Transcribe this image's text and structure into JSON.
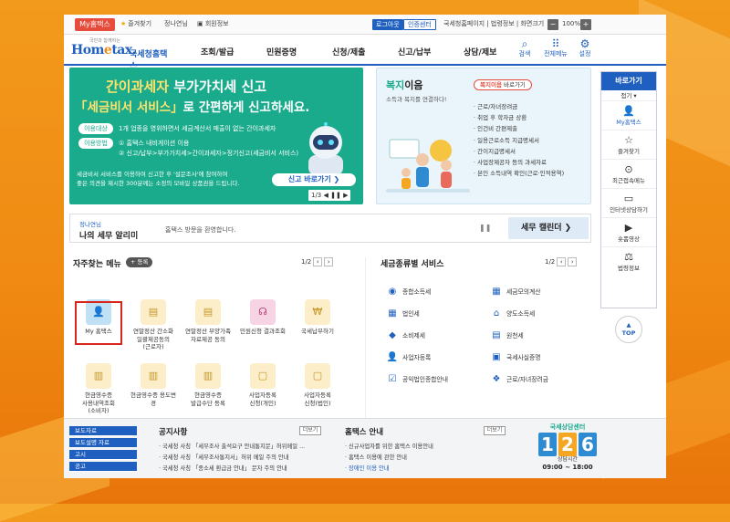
{
  "util": {
    "mytax": "My홈택스",
    "favorite": "즐겨찾기",
    "user": "정나연님",
    "member_info": "회원정보",
    "logout": "로그아웃",
    "auth_center": "인증센터",
    "links": "국세청홈페이지 | 법령정보 | 화면크기",
    "zoom": "100%"
  },
  "header": {
    "logo_sub": "국민과 함께하는",
    "logo_main_a": "Hom",
    "logo_main_e": "e",
    "logo_main_b": "tax.",
    "logo_kr": "국세청홈택스",
    "gnb": [
      "조회/발급",
      "민원증명",
      "신청/제출",
      "신고/납부",
      "상담/제보"
    ],
    "search": "검색",
    "all_menu": "전체메뉴",
    "settings": "설정"
  },
  "banner": {
    "line1_a": "간이과세자",
    "line1_b": " 부가가치세 신고",
    "line2_a": "「세금비서 서비스」",
    "line2_b": "로 간편하게 신고하세요.",
    "tag1": "이용대상",
    "text1": "1개 업종을 영위하면서 세금계산서 매출이 없는 간이과세자",
    "tag2": "이용방법",
    "text2a": "① 홈택스 내비게이션 이용",
    "text2b": "② 신고/납부>부가가치세>간이과세자>정기신고(세금비서 서비스)",
    "foot1": "세금비서 서비스를 이용하여 신고한 후 '설문조사'에 참여하여",
    "foot2": "좋은 의견을 제시한 300분께는 소정의 모바일 상품권을 드립니다.",
    "cta": "신고 바로가기 ❯",
    "page": "1/3"
  },
  "welfare": {
    "title_a": "복지",
    "title_b": "이음",
    "btn_a": "복지이음",
    "btn_b": " 바로가기",
    "sub": "소득과 복지를 연결하다!",
    "items": [
      "근로/자녀장려금",
      "취업 후 학자금 상환",
      "인건비 간편제출",
      "일용근로소득 지급명세서",
      "간이지급명세서",
      "사업장제공자 등의 과세자료",
      "본인 소득내역 확인(근로·인적용역)"
    ]
  },
  "quick": {
    "title": "바로가기",
    "fold": "접기 ▾",
    "items": [
      "My홈택스",
      "즐겨찾기",
      "최근접속메뉴",
      "인터넷상담하기",
      "숏폼영상",
      "법령정보"
    ],
    "top": "TOP"
  },
  "strip": {
    "name": "정나연님",
    "title": "나의 세무 알리미",
    "msg": "홈택스 방문을 환영합니다.",
    "calendar": "세무 캘린더  ❯"
  },
  "freq": {
    "title": "자주찾는 메뉴",
    "add": "+ 등록",
    "page": "1/2",
    "items": [
      "My 홈택스",
      "연말정산 간소화\n일괄제공동의\n(근로자)",
      "연말정산 부양가족\n자료제공 동의",
      "민원신청 결과조회",
      "국세납부하기",
      "현금영수증\n사용내역조회\n(소비자)",
      "현금영수증 용도변\n경",
      "현금영수증\n발급수단 등록",
      "사업자등록\n신청(개인)",
      "사업자등록\n신청(법인)"
    ]
  },
  "svc": {
    "title": "세금종류별 서비스",
    "page": "1/2",
    "left": [
      "종합소득세",
      "법인세",
      "소비제세",
      "사업자등록",
      "공익법인종합안내"
    ],
    "right": [
      "세금모의계산",
      "양도소득세",
      "원천세",
      "국세사실증명",
      "근로/자녀장려금"
    ]
  },
  "footer": {
    "tabs": [
      "보도자료",
      "보도설명 자료",
      "고시",
      "공고"
    ],
    "notice_title": "공지사항",
    "notices": [
      "국세청 사칭 「세무조사 출석요구 안내통지문」허위메일 ...",
      "국세청 사칭 「세무조사통지서」허위 메일 주의 안내",
      "국세청 사칭 「종소세 환급금 안내」 문자 주의 안내"
    ],
    "guide_title": "홈택스 안내",
    "guides": [
      "신규사업자를 위한 홈택스 이용안내",
      "홈택스 이용에 관한 안내",
      "장애인 이용 안내"
    ],
    "more": "더보기",
    "cc_top": "국세상담센터",
    "cc_digits": [
      "1",
      "2",
      "6"
    ],
    "cc_label": "상담시간",
    "cc_time": "09:00 ~ 18:00"
  }
}
